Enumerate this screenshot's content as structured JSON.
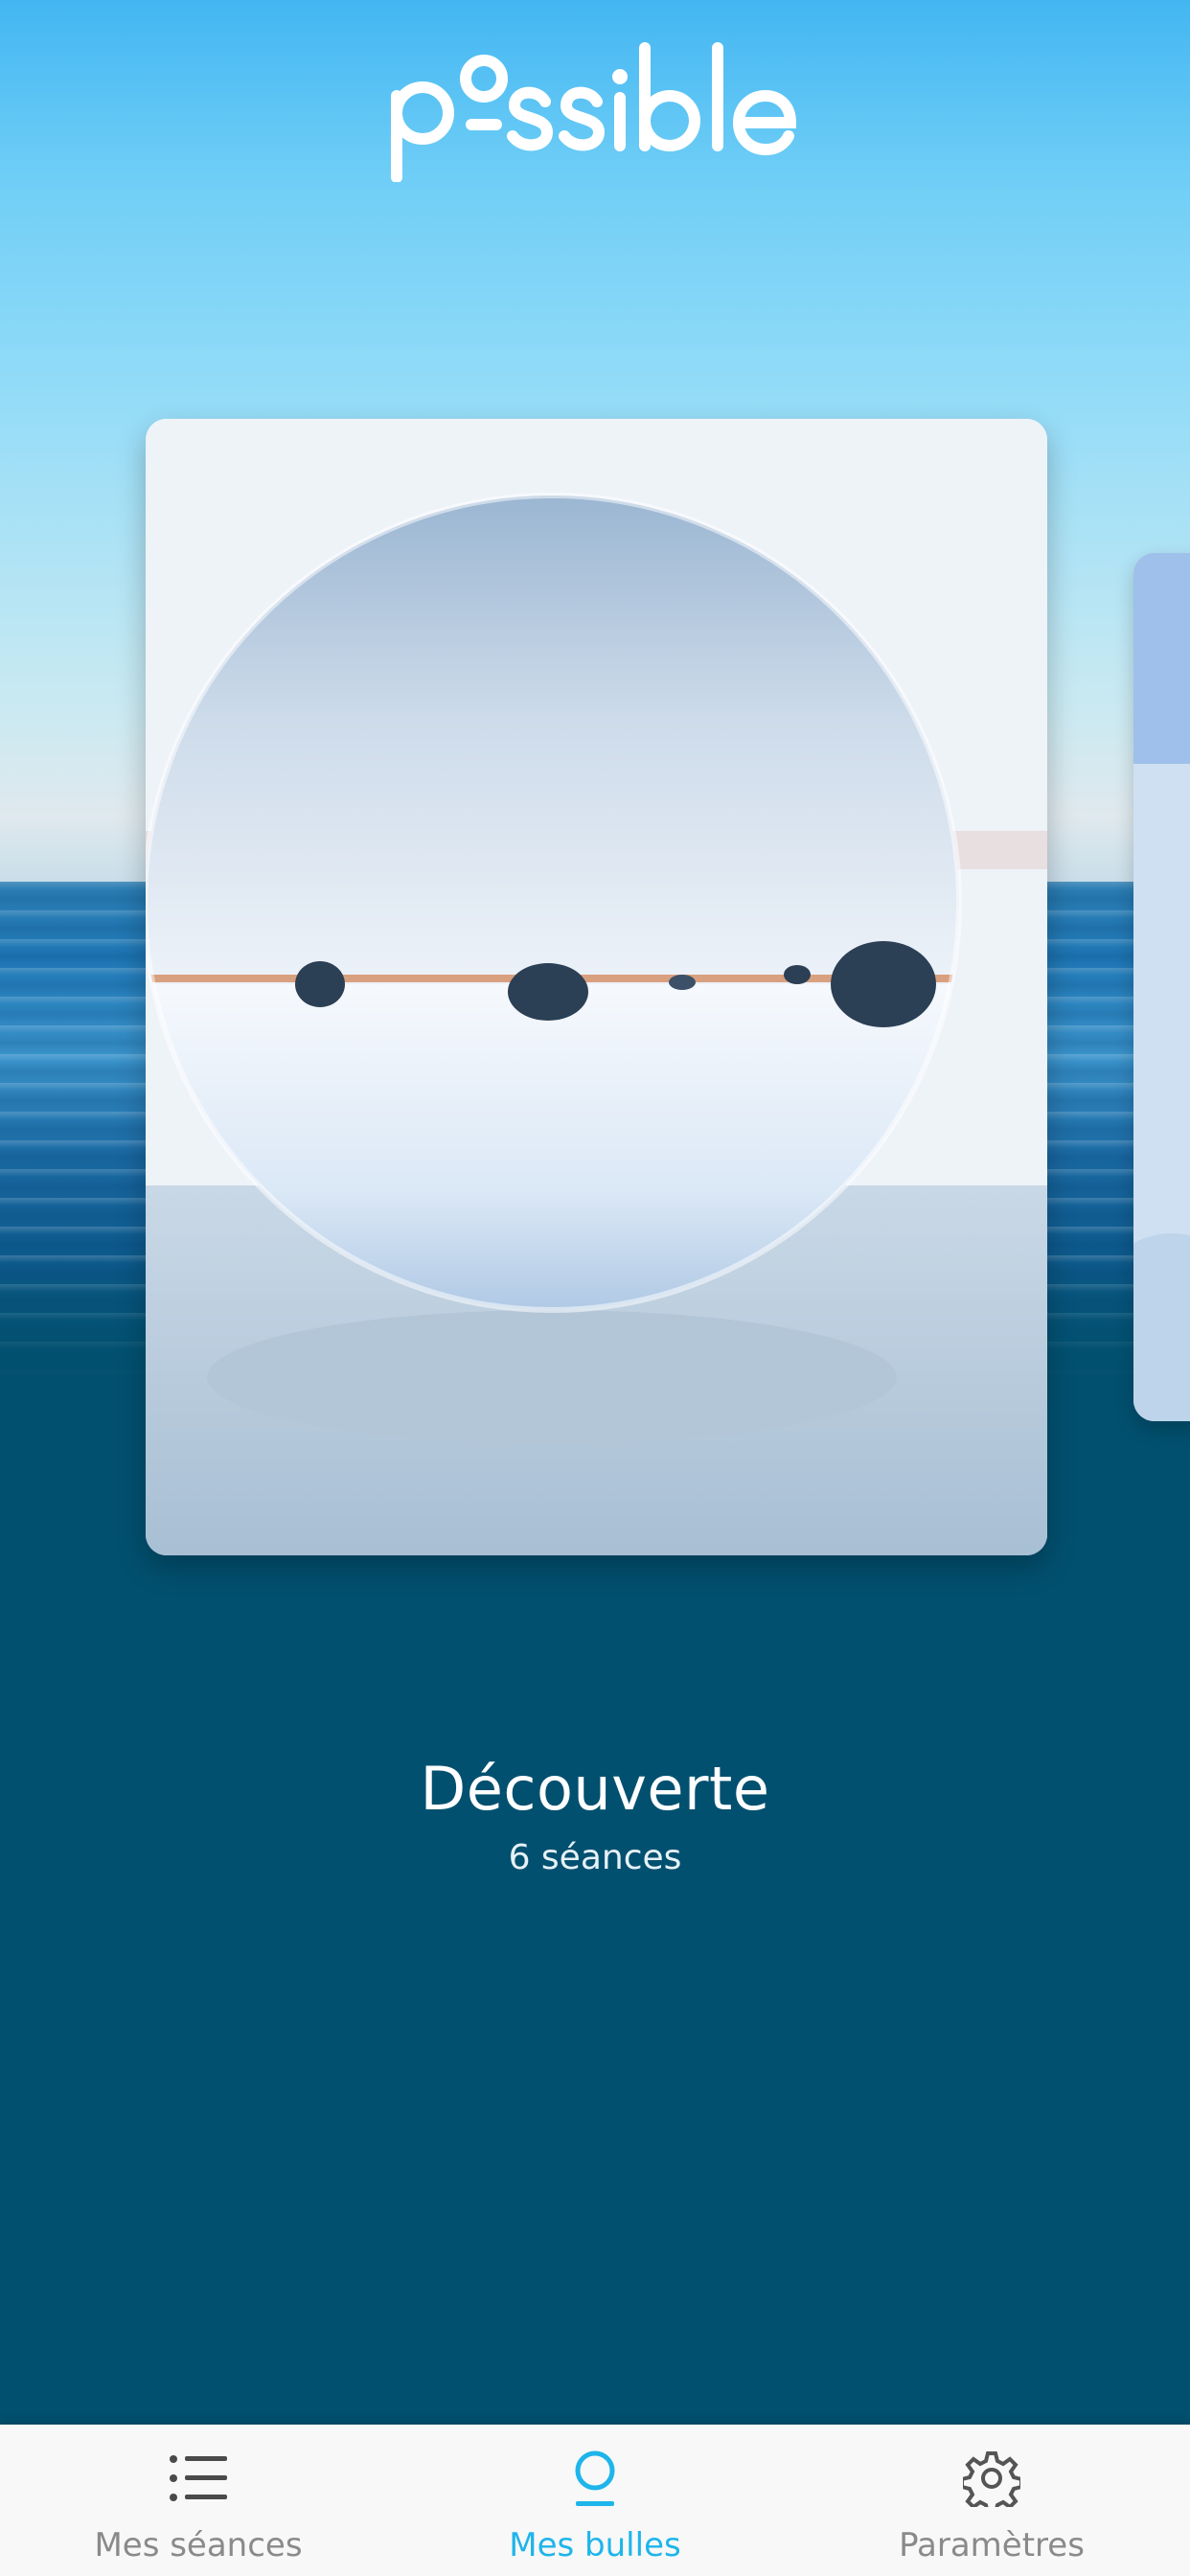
{
  "header": {
    "logo_text": "possible",
    "logo_icon": "possible-logo"
  },
  "carousel": {
    "current_card": {
      "title": "Découverte",
      "subtitle": "6 séances",
      "image": "crystal-ball-on-ice-photo"
    },
    "next_card": {
      "image": "water-photo-peek"
    }
  },
  "tabbar": {
    "tabs": [
      {
        "label": "Mes séances",
        "icon": "list-icon",
        "active": false
      },
      {
        "label": "Mes bulles",
        "icon": "bubble-icon",
        "active": true
      },
      {
        "label": "Paramètres",
        "icon": "gear-icon",
        "active": false
      }
    ]
  },
  "colors": {
    "accent": "#1eb5ea",
    "background_dark": "#02506f",
    "tab_inactive": "#8a8a8a",
    "tabbar_bg": "#f8f8f8",
    "text_light": "#ffffff"
  }
}
